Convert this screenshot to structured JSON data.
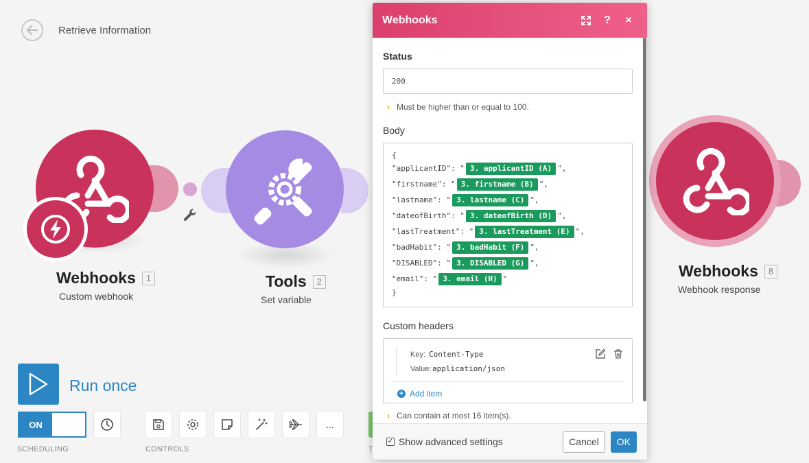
{
  "header": {
    "scenario_title": "Retrieve Information"
  },
  "nodes": [
    {
      "title": "Webhooks",
      "number": "1",
      "subtitle": "Custom webhook"
    },
    {
      "title": "Tools",
      "number": "2",
      "subtitle": "Set variable"
    },
    {
      "title": "Webhooks",
      "number": "8",
      "subtitle": "Webhook response"
    }
  ],
  "toolbar": {
    "run_label": "Run once",
    "toggle_on": "ON",
    "scheduling_label": "SCHEDULING",
    "controls_label": "CONTROLS",
    "cut_label": "T",
    "more_label": "..."
  },
  "modal": {
    "title": "Webhooks",
    "status_label": "Status",
    "status_value": "200",
    "status_hint": "Must be higher than or equal to 100.",
    "body_label": "Body",
    "body_open": "{",
    "body_close": "}",
    "body_lines": [
      {
        "key": "\"applicantID\": \"",
        "pill": "3. applicantID (A)",
        "tail": "\","
      },
      {
        "key": "\"firstname\": \"",
        "pill": "3. firstname (B)",
        "tail": "\","
      },
      {
        "key": "\"lastname\": \"",
        "pill": "3. lastname (C)",
        "tail": "\","
      },
      {
        "key": "\"dateofBirth\": \"",
        "pill": "3. dateofBirth (D)",
        "tail": "\","
      },
      {
        "key": "\"lastTreatment\": \"",
        "pill": "3. lastTreatment (E)",
        "tail": "\","
      },
      {
        "key": "\"badHabit\": \"",
        "pill": "3. badHabit (F)",
        "tail": "\","
      },
      {
        "key": "\"DISABLED\": \"",
        "pill": "3. DISABLED (G)",
        "tail": "\","
      },
      {
        "key": "\"email\": \"",
        "pill": "3. email (H)",
        "tail": "\""
      }
    ],
    "headers_label": "Custom headers",
    "header_key_label": "Key:",
    "header_key": "Content-Type",
    "header_value_label": "Value:",
    "header_value": "application/json",
    "add_item": "Add item",
    "headers_hint": "Can contain at most 16 item(s).",
    "advanced_label": "Show advanced settings",
    "advanced_checked": true,
    "cancel": "Cancel",
    "ok": "OK"
  },
  "colors": {
    "webhook_red": "#c9335b",
    "tools_purple": "#9f7fe0",
    "accent_blue": "#2c86c4",
    "pill_green": "#1a9a5c",
    "header_pink": "#e24a76"
  }
}
